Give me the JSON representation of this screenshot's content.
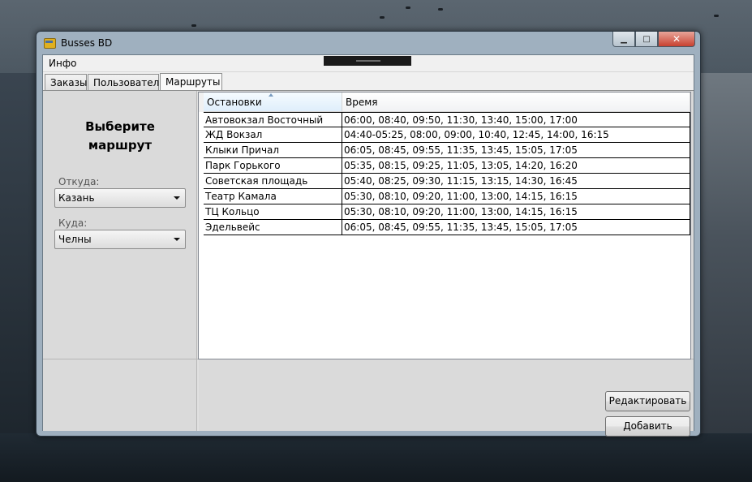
{
  "window": {
    "title": "Busses BD"
  },
  "menu": {
    "items": [
      "Инфо"
    ]
  },
  "tabs": [
    "Заказы",
    "Пользователи",
    "Маршруты"
  ],
  "active_tab": "Маршруты",
  "left_panel": {
    "prompt_line1": "Выберите",
    "prompt_line2": "маршрут",
    "from_label": "Откуда:",
    "from_value": "Казань",
    "to_label": "Куда:",
    "to_value": "Челны"
  },
  "table": {
    "columns": [
      "Остановки",
      "Время"
    ],
    "rows": [
      [
        "Автовокзал Восточный",
        "06:00, 08:40, 09:50, 11:30, 13:40, 15:00, 17:00"
      ],
      [
        "ЖД Вокзал",
        "04:40-05:25, 08:00, 09:00, 10:40, 12:45, 14:00, 16:15"
      ],
      [
        "Клыки Причал",
        "06:05, 08:45, 09:55, 11:35, 13:45, 15:05, 17:05"
      ],
      [
        "Парк Горького",
        "05:35, 08:15, 09:25, 11:05, 13:05, 14:20, 16:20"
      ],
      [
        "Советская площадь",
        "05:40, 08:25, 09:30, 11:15, 13:15, 14:30, 16:45"
      ],
      [
        "Театр Камала",
        "05:30, 08:10, 09:20, 11:00, 13:00, 14:15, 16:15"
      ],
      [
        "ТЦ Кольцо",
        "05:30, 08:10, 09:20, 11:00, 13:00, 14:15, 16:15"
      ],
      [
        "Эдельвейс",
        "06:05, 08:45, 09:55, 11:35, 13:45, 15:05, 17:05"
      ]
    ]
  },
  "buttons": {
    "edit": "Редактировать",
    "add": "Добавить"
  },
  "caption": {
    "minimize_icon": "minimize-icon",
    "maximize_icon": "maximize-icon",
    "close_icon": "close-icon"
  }
}
